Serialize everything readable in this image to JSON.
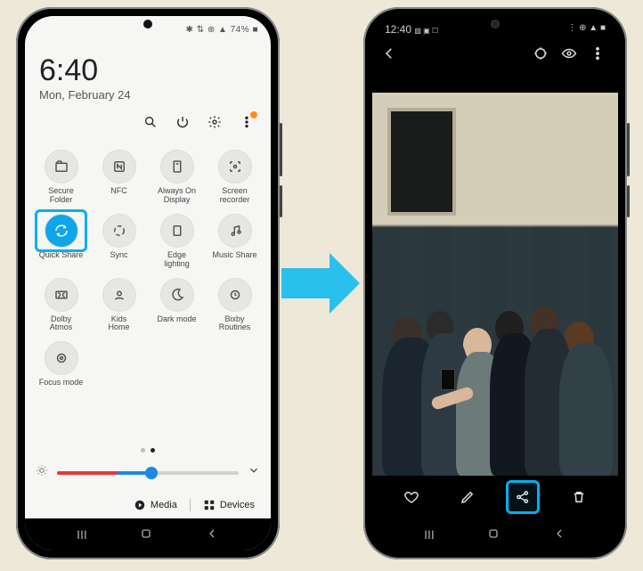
{
  "left": {
    "status_text": "✱ ⇅ ⊕ ▲ 74% ■",
    "time": "6:40",
    "date": "Mon, February 24",
    "util_icons": {
      "search": "search-icon",
      "power": "power-icon",
      "settings": "gear-icon",
      "more": "more-icon"
    },
    "tiles": [
      {
        "id": "secure-folder",
        "label": "Secure\nFolder",
        "active": false,
        "highlight": false
      },
      {
        "id": "nfc",
        "label": "NFC",
        "active": false,
        "highlight": false
      },
      {
        "id": "always-on",
        "label": "Always On\nDisplay",
        "active": false,
        "highlight": false
      },
      {
        "id": "screen-rec",
        "label": "Screen\nrecorder",
        "active": false,
        "highlight": false
      },
      {
        "id": "quick-share",
        "label": "Quick Share",
        "active": true,
        "highlight": true
      },
      {
        "id": "sync",
        "label": "Sync",
        "active": false,
        "highlight": false
      },
      {
        "id": "edge-light",
        "label": "Edge\nlighting",
        "active": false,
        "highlight": false
      },
      {
        "id": "music-share",
        "label": "Music Share",
        "active": false,
        "highlight": false
      },
      {
        "id": "dolby",
        "label": "Dolby\nAtmos",
        "active": false,
        "highlight": false
      },
      {
        "id": "kids-home",
        "label": "Kids\nHome",
        "active": false,
        "highlight": false
      },
      {
        "id": "dark-mode",
        "label": "Dark mode",
        "active": false,
        "highlight": false
      },
      {
        "id": "bixby",
        "label": "Bixby\nRoutines",
        "active": false,
        "highlight": false
      },
      {
        "id": "focus",
        "label": "Focus mode",
        "active": false,
        "highlight": false
      }
    ],
    "brightness_pct": 52,
    "media_label": "Media",
    "devices_label": "Devices"
  },
  "right": {
    "status_time": "12:40",
    "status_left_glyphs": "▧ ▣ ☐",
    "status_right_glyphs": "⋮ ⊕ ▲ ■",
    "photo_alt": "Group of six people posing together outdoors in front of a stone wall, one holding a phone taking a selfie",
    "toolbar": {
      "heart": "favorite-icon",
      "edit": "edit-icon",
      "share": "share-icon",
      "delete": "trash-icon"
    },
    "share_highlight": true
  },
  "colors": {
    "accent": "#00b0ef",
    "active_tile": "#0ea5e9"
  }
}
